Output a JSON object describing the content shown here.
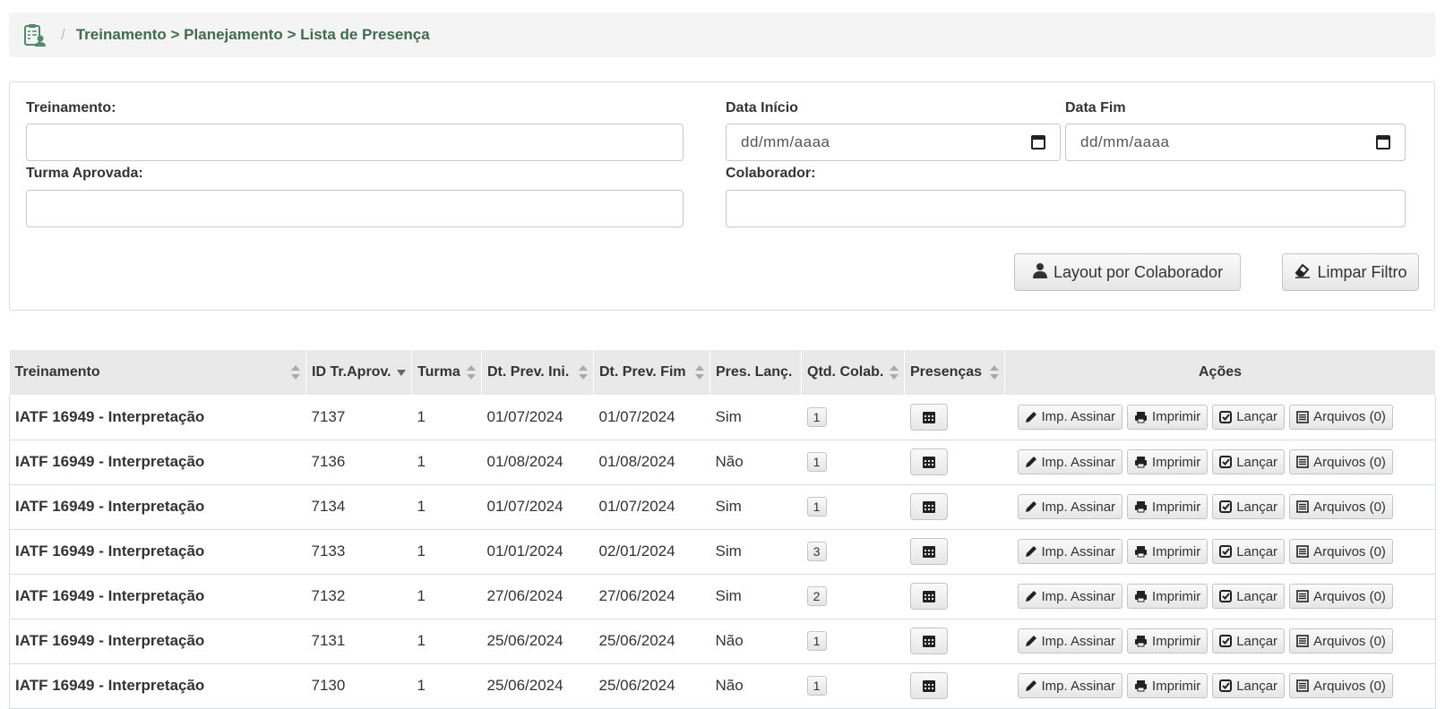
{
  "breadcrumb": {
    "text": "Treinamento > Planejamento > Lista de Presença",
    "separator": "/"
  },
  "filters": {
    "treinamento_label": "Treinamento:",
    "treinamento_value": "",
    "data_inicio_label": "Data Início",
    "data_inicio_placeholder": "dd/mm/aaaa",
    "data_fim_label": "Data Fim",
    "data_fim_placeholder": "dd/mm/aaaa",
    "turma_label": "Turma Aprovada:",
    "turma_value": "",
    "colaborador_label": "Colaborador:",
    "colaborador_value": "",
    "layout_button": "Layout por Colaborador",
    "limpar_button": "Limpar Filtro"
  },
  "table": {
    "columns": [
      "Treinamento",
      "ID Tr.Aprov.",
      "Turma",
      "Dt. Prev. Ini.",
      "Dt. Prev. Fim",
      "Pres. Lanç.",
      "Qtd. Colab.",
      "Presenças",
      "Ações"
    ],
    "action_labels": {
      "assinar": "Imp. Assinar",
      "imprimir": "Imprimir",
      "lancar": "Lançar",
      "arquivos": "Arquivos (0)"
    },
    "rows": [
      {
        "treinamento": "IATF 16949 - Interpretação",
        "id": "7137",
        "turma": "1",
        "ini": "01/07/2024",
        "fim": "01/07/2024",
        "pres": "Sim",
        "qtd": "1"
      },
      {
        "treinamento": "IATF 16949 - Interpretação",
        "id": "7136",
        "turma": "1",
        "ini": "01/08/2024",
        "fim": "01/08/2024",
        "pres": "Não",
        "qtd": "1"
      },
      {
        "treinamento": "IATF 16949 - Interpretação",
        "id": "7134",
        "turma": "1",
        "ini": "01/07/2024",
        "fim": "01/07/2024",
        "pres": "Sim",
        "qtd": "1"
      },
      {
        "treinamento": "IATF 16949 - Interpretação",
        "id": "7133",
        "turma": "1",
        "ini": "01/01/2024",
        "fim": "02/01/2024",
        "pres": "Sim",
        "qtd": "3"
      },
      {
        "treinamento": "IATF 16949 - Interpretação",
        "id": "7132",
        "turma": "1",
        "ini": "27/06/2024",
        "fim": "27/06/2024",
        "pres": "Sim",
        "qtd": "2"
      },
      {
        "treinamento": "IATF 16949 - Interpretação",
        "id": "7131",
        "turma": "1",
        "ini": "25/06/2024",
        "fim": "25/06/2024",
        "pres": "Não",
        "qtd": "1"
      },
      {
        "treinamento": "IATF 16949 - Interpretação",
        "id": "7130",
        "turma": "1",
        "ini": "25/06/2024",
        "fim": "25/06/2024",
        "pres": "Não",
        "qtd": "1"
      }
    ]
  },
  "colors": {
    "breadcrumb_text": "#3e6b52",
    "header_bg": "#e9e9e9",
    "row_border": "#cfe0f0"
  },
  "icons": {
    "breadcrumb": "clipboard-user-icon",
    "layout": "user-icon",
    "limpar": "eraser-icon",
    "presencas": "calendar-icon"
  }
}
